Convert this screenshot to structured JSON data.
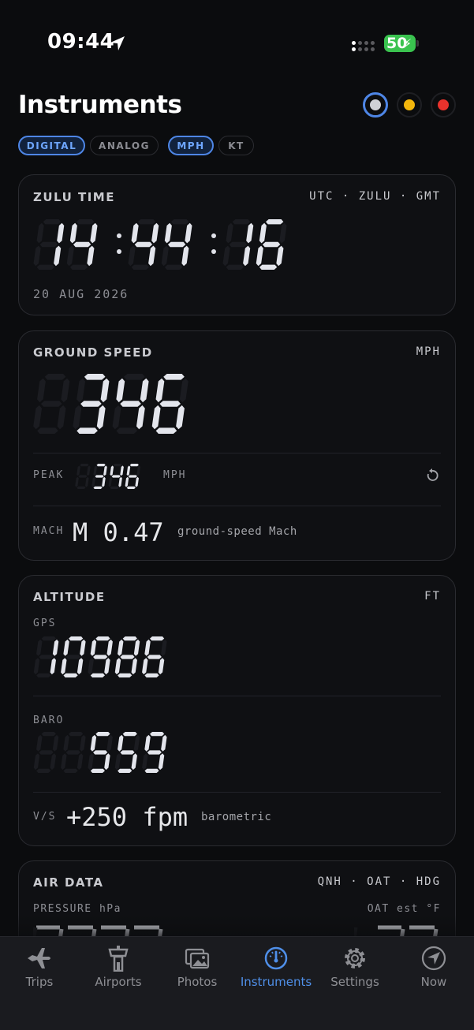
{
  "status_bar": {
    "time": "09:44",
    "battery": "50"
  },
  "header": {
    "title": "Instruments"
  },
  "theme_colors": [
    "#d0d1d6",
    "#f2b60c",
    "#e8322c"
  ],
  "accent": "#4e86e6",
  "pills": {
    "digital": "DIGITAL",
    "analog": "ANALOG",
    "mph": "MPH",
    "kt": "KT"
  },
  "zulu": {
    "label": "ZULU TIME",
    "zones": "UTC · ZULU · GMT",
    "hh": "14",
    "mm": "44",
    "ss": "16",
    "date": "20 AUG 2026"
  },
  "ground_speed": {
    "label": "GROUND SPEED",
    "unit": "MPH",
    "value": "346",
    "peak_label": "PEAK",
    "peak_value": "346",
    "peak_unit": "MPH",
    "mach_label": "MACH",
    "mach_value": "M 0.47",
    "mach_note": "ground-speed Mach"
  },
  "altitude": {
    "label": "ALTITUDE",
    "unit": "FT",
    "gps_label": "GPS",
    "gps_value": "10986",
    "baro_label": "BARO",
    "baro_value": "559",
    "vs_label": "V/S",
    "vs_value": "+250 fpm",
    "vs_note": "barometric"
  },
  "air_data": {
    "label": "AIR DATA",
    "tags": "QNH · OAT · HDG",
    "pressure_label": "PRESSURE hPa",
    "oat_label": "OAT est °F"
  },
  "tabs": [
    {
      "label": "Trips",
      "icon": "airplane-icon"
    },
    {
      "label": "Airports",
      "icon": "control-tower-icon"
    },
    {
      "label": "Photos",
      "icon": "photos-icon"
    },
    {
      "label": "Instruments",
      "icon": "gauge-icon"
    },
    {
      "label": "Settings",
      "icon": "gear-icon"
    },
    {
      "label": "Now",
      "icon": "navigation-arrow-icon"
    }
  ]
}
